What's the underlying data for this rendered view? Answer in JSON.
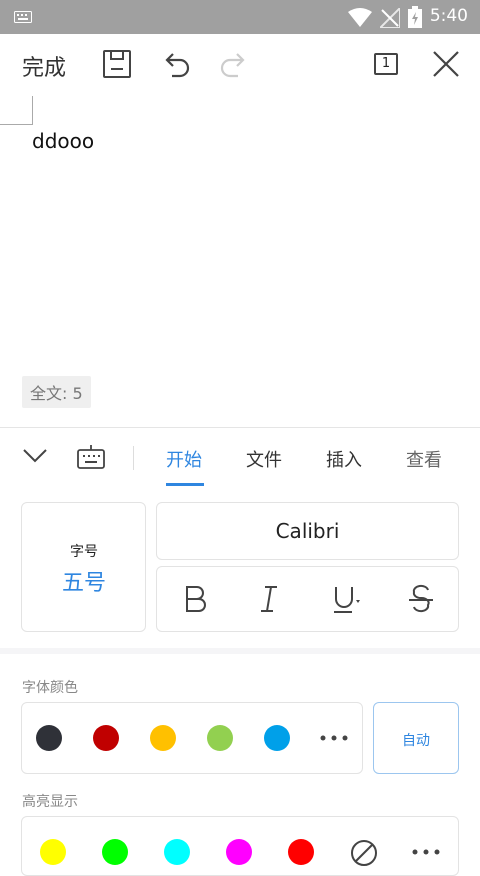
{
  "status_bar": {
    "time": "5:40"
  },
  "toolbar": {
    "done_label": "完成",
    "page_number": "1"
  },
  "document": {
    "text": "ddooo",
    "word_count": "全文: 5"
  },
  "tabs": [
    {
      "label": "开始",
      "active": true
    },
    {
      "label": "文件",
      "active": false
    },
    {
      "label": "插入",
      "active": false
    },
    {
      "label": "查看",
      "active": false
    }
  ],
  "font": {
    "size_label": "字号",
    "size_value": "五号",
    "family": "Calibri"
  },
  "font_color": {
    "title": "字体颜色",
    "colors": [
      "#2f3138",
      "#c00000",
      "#ffc000",
      "#92d050",
      "#00a0e9"
    ],
    "auto_label": "自动"
  },
  "highlight": {
    "title": "高亮显示",
    "colors": [
      "#ffff00",
      "#00ff00",
      "#00ffff",
      "#ff00ff",
      "#ff0000"
    ]
  },
  "accent": "#2f86e0"
}
